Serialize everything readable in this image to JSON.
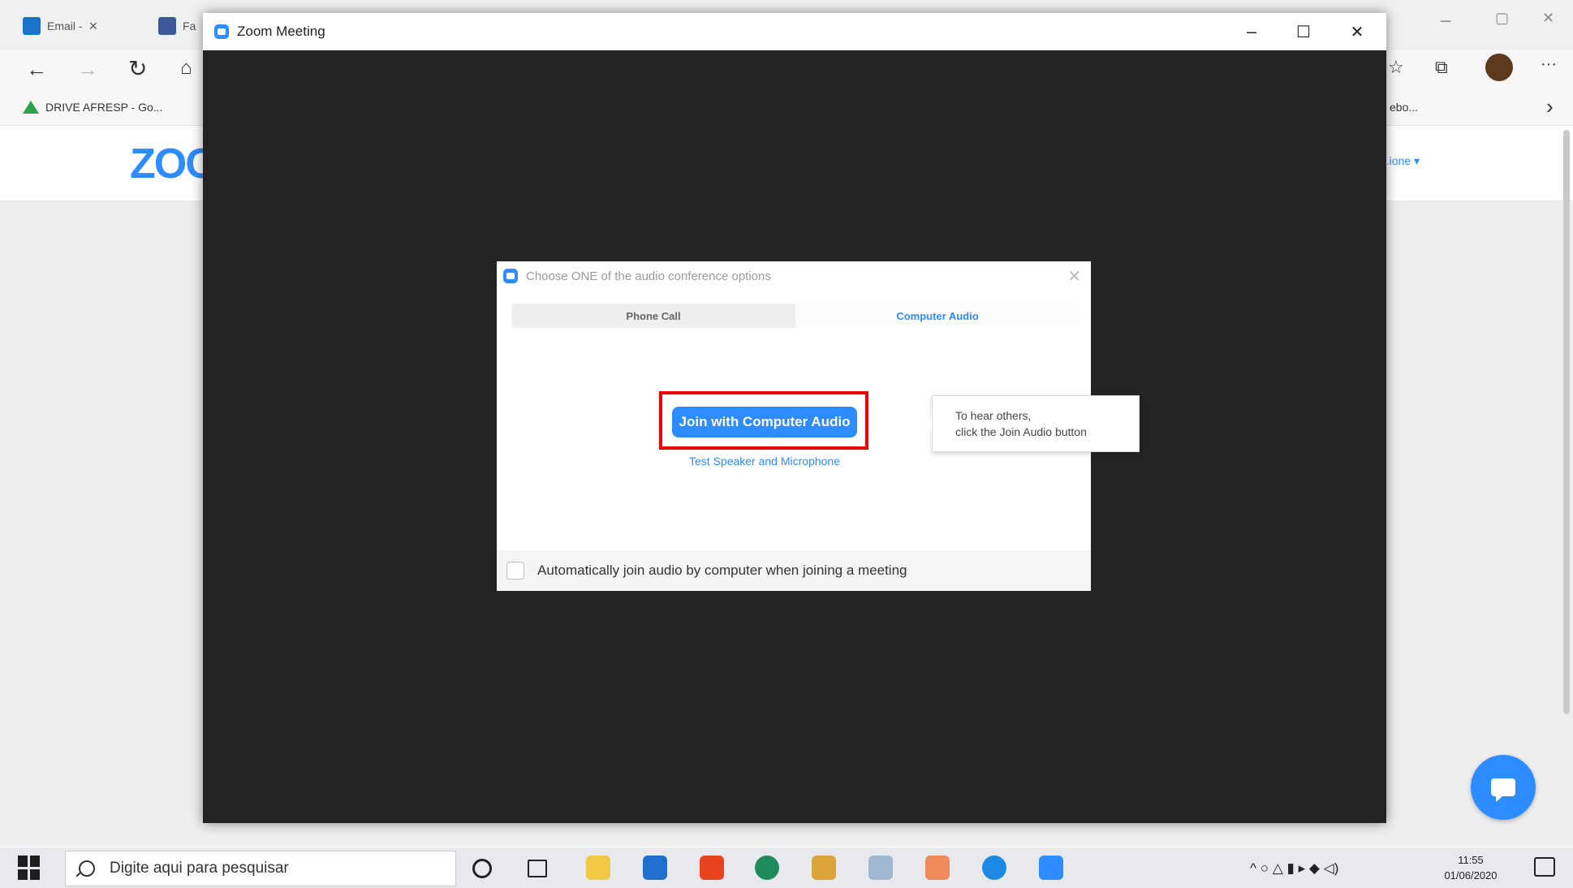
{
  "browser": {
    "tabs": [
      {
        "icon": "outlook-icon",
        "label": "Email - ",
        "close": "×"
      },
      {
        "icon": "facebook-icon",
        "label": "Fa"
      }
    ],
    "bookmark": "DRIVE AFRESP - Go...",
    "bookmark_right": "ebo...",
    "window_controls": {
      "minimize": "–",
      "maximize": "▢",
      "close": "✕"
    },
    "more_menu": "···",
    "chevron": "›"
  },
  "site": {
    "logo": "ZOO",
    "menu": "...ione ▾"
  },
  "zoom_window": {
    "title": "Zoom Meeting",
    "minimize": "–",
    "maximize": "☐",
    "close": "✕"
  },
  "audio_dialog": {
    "title": "Choose ONE of the audio conference options",
    "close": "✕",
    "tabs": [
      {
        "label": "Phone Call",
        "active": false
      },
      {
        "label": "Computer Audio",
        "active": true
      }
    ],
    "join_button": "Join with Computer Audio",
    "test_link": "Test Speaker and Microphone",
    "auto_join_label": "Automatically join audio by computer when joining a meeting",
    "auto_join_checked": false
  },
  "tooltip": {
    "line1": "To hear others,",
    "line2": "click the Join Audio button"
  },
  "taskbar": {
    "search_placeholder": "Digite aqui para pesquisar",
    "apps": [
      "cortana-icon",
      "task-view-icon",
      "file-explorer-icon",
      "mail-icon",
      "office-icon",
      "edge-icon",
      "photos-icon",
      "notes-icon",
      "powerpoint-icon",
      "skype-icon",
      "zoom-icon"
    ],
    "tray_icons": "^ ○ △ ▮ ▸ ◆ ◁)",
    "time": "11:55",
    "date": "01/06/2020"
  },
  "colors": {
    "zoom_blue": "#2d8cff",
    "highlight_red": "#ee0000",
    "meeting_bg": "#232323"
  }
}
